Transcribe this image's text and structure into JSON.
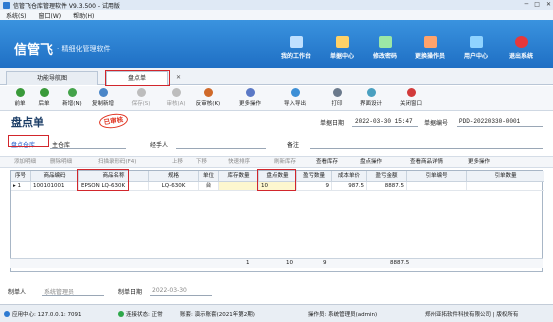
{
  "window": {
    "title": "信管飞仓库管理软件 V9.3.500 - 试用版",
    "controls": [
      "─",
      "□",
      "✕"
    ]
  },
  "menu": [
    "系统(S)",
    "窗口(W)",
    "帮助(H)"
  ],
  "banner": {
    "logo": "信管飞",
    "slogan": "· 精细化管理软件",
    "buttons": [
      {
        "label": "我的工作台",
        "icon": "monitor-icon",
        "color": "#bfe0ff"
      },
      {
        "label": "单据中心",
        "icon": "documents-icon",
        "color": "#ffd166"
      },
      {
        "label": "修改密码",
        "icon": "key-icon",
        "color": "#9be7a6"
      },
      {
        "label": "更换操作员",
        "icon": "user-switch-icon",
        "color": "#ffa36b"
      },
      {
        "label": "用户中心",
        "icon": "users-icon",
        "color": "#8fd3ff"
      },
      {
        "label": "退出系统",
        "icon": "power-icon",
        "color": "#e5383b"
      }
    ]
  },
  "tabs": [
    {
      "label": "功能导航图"
    },
    {
      "label": "盘点单",
      "close": "✕"
    }
  ],
  "toolbar": [
    {
      "label": "前单",
      "icon": "arrow-left-icon",
      "color": "#3a9a3a"
    },
    {
      "label": "后单",
      "icon": "arrow-right-icon",
      "color": "#3a9a3a"
    },
    {
      "label": "新增(N)",
      "icon": "add-icon",
      "color": "#44a34a"
    },
    {
      "label": "复制新增",
      "icon": "copy-icon",
      "color": "#4a86c8"
    },
    {
      "label": "保存(S)",
      "icon": "save-icon",
      "color": "#9a9a9a",
      "disabled": true
    },
    {
      "label": "审核(A)",
      "icon": "approve-icon",
      "color": "#9a9a9a",
      "disabled": true
    },
    {
      "label": "反审核(K)",
      "icon": "unapprove-icon",
      "color": "#d06a2a"
    },
    {
      "label": "更多操作",
      "icon": "more-ops-icon",
      "color": "#5b79c6"
    },
    {
      "label": "导入导出",
      "icon": "import-export-icon",
      "color": "#3d8fd6"
    },
    {
      "label": "打印",
      "icon": "print-icon",
      "color": "#6b7a8c"
    },
    {
      "label": "界面设计",
      "icon": "design-icon",
      "color": "#4aa0c0"
    },
    {
      "label": "关闭窗口",
      "icon": "close-window-icon",
      "color": "#d23b3b"
    }
  ],
  "doc": {
    "title": "盘点单",
    "stamp": "已审核",
    "date_label": "单据日期",
    "date_value": "2022-03-30 15:47",
    "number_label": "单据编号",
    "number_value": "PDD-20220330-0001",
    "warehouse_label": "盘点仓库",
    "warehouse_value": "主仓库",
    "handler_label": "经手人",
    "handler_value": "",
    "remark_label": "备注",
    "remark_value": ""
  },
  "grid_toolbar": [
    "添加明细",
    "删除明细",
    "扫描录形码(F4)",
    "上移",
    "下移",
    "快速排序",
    "刷新库存",
    "查看库存",
    "盘点操作",
    "查看商品详情",
    "更多操作"
  ],
  "table": {
    "columns": [
      "序号",
      "商品编码",
      "商品名称",
      "规格",
      "单位",
      "库存数量",
      "盘点数量",
      "盈亏数量",
      "成本单价",
      "盈亏金额",
      "引单编号",
      "引单数量"
    ],
    "rows": [
      {
        "marker": "▸",
        "cells": [
          "1",
          "100101001",
          "EPSON LQ-630K",
          "LQ-630K",
          "台",
          "",
          "10",
          "9",
          "987.5",
          "8887.5",
          "",
          ""
        ]
      }
    ],
    "sums": {
      "stock": "1",
      "count": "10",
      "diff": "9",
      "amount": "8887.5"
    }
  },
  "footer": {
    "maker_label": "制单人",
    "maker_value": "系统管理员",
    "make_date_label": "制单日期",
    "make_date_value": "2022-03-30"
  },
  "status": {
    "server": "应用中心: 127.0.0.1: 7091",
    "connection": "连接状态: 正常",
    "account": "账套: 演示账套(2021年第2期)",
    "operator": "操作员: 系统管理员(admin)",
    "company": "郑州亚拓软件科技有限公司 | 版权所有"
  }
}
